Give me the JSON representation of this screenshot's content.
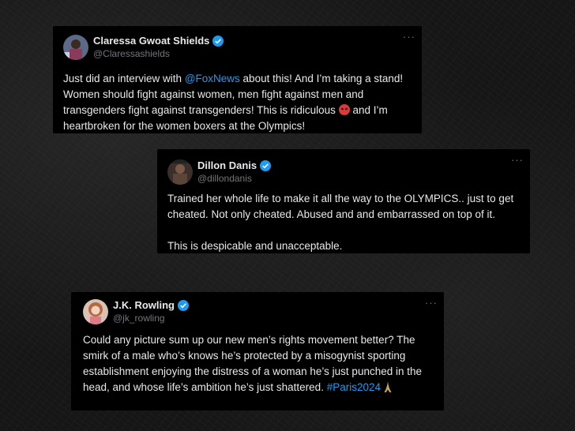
{
  "tweets": [
    {
      "name": "Claressa Gwoat Shields",
      "handle": "@Claressashields",
      "more": "···",
      "text_pre": "Just did an interview with ",
      "mention": "@FoxNews",
      "text_mid": " about this! And I’m taking a stand! Women should fight against women, men fight against men and transgenders fight against transgenders! This is ridiculous ",
      "emoji": "angry-face-icon",
      "text_post": " and I’m heartbroken for the women boxers at the Olympics!"
    },
    {
      "name": "Dillon Danis",
      "handle": "@dillondanis",
      "more": "···",
      "para1": "Trained her whole life to make it all the way to the OLYMPICS.. just to get cheated. Not only cheated. Abused and and embarrassed on top of it.",
      "para2": "This is despicable and unacceptable."
    },
    {
      "name": "J.K. Rowling",
      "handle": "@jk_rowling",
      "more": "···",
      "text": "Could any picture sum up our new men’s rights movement better? The smirk of a male who’s knows he’s protected by a misogynist sporting establishment enjoying the distress of a woman he’s just punched in the head, and whose life’s ambition he’s just shattered. ",
      "hashtag": "#Paris2024",
      "emoji": "eiffel-tower-icon"
    }
  ],
  "colors": {
    "card_bg": "#000000",
    "text": "#e7e9ea",
    "muted": "#71767b",
    "link": "#1d9bf0",
    "verified": "#1d9bf0"
  }
}
